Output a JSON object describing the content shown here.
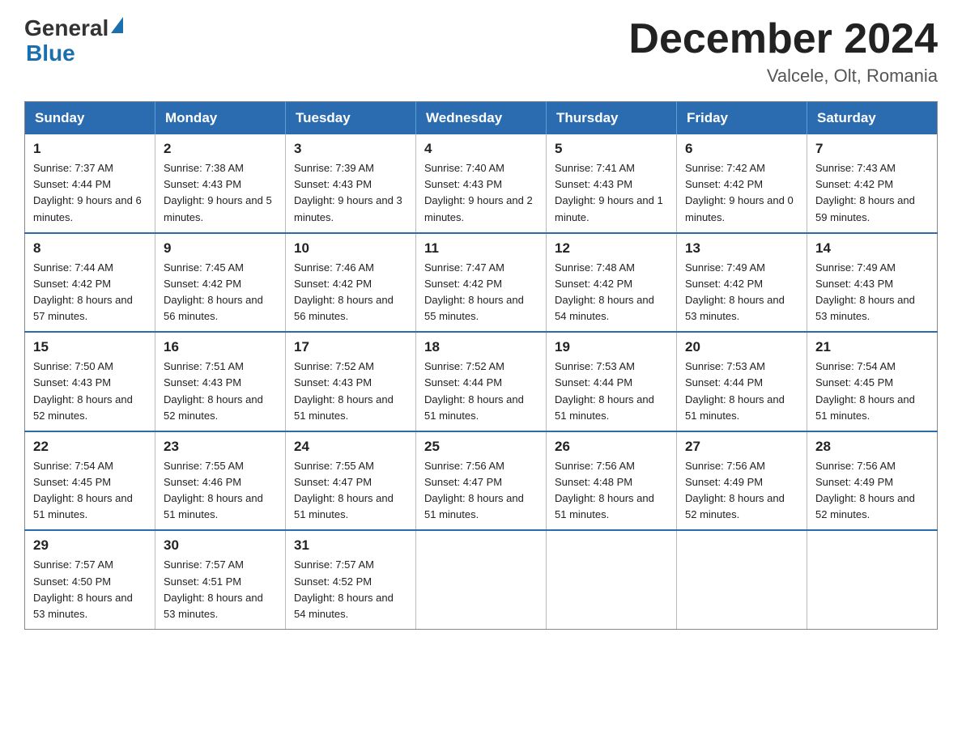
{
  "logo": {
    "general": "General",
    "blue": "Blue",
    "arrow_shape": "▶"
  },
  "header": {
    "month_year": "December 2024",
    "location": "Valcele, Olt, Romania"
  },
  "days_of_week": [
    "Sunday",
    "Monday",
    "Tuesday",
    "Wednesday",
    "Thursday",
    "Friday",
    "Saturday"
  ],
  "weeks": [
    [
      {
        "day": "1",
        "sunrise": "7:37 AM",
        "sunset": "4:44 PM",
        "daylight": "9 hours and 6 minutes."
      },
      {
        "day": "2",
        "sunrise": "7:38 AM",
        "sunset": "4:43 PM",
        "daylight": "9 hours and 5 minutes."
      },
      {
        "day": "3",
        "sunrise": "7:39 AM",
        "sunset": "4:43 PM",
        "daylight": "9 hours and 3 minutes."
      },
      {
        "day": "4",
        "sunrise": "7:40 AM",
        "sunset": "4:43 PM",
        "daylight": "9 hours and 2 minutes."
      },
      {
        "day": "5",
        "sunrise": "7:41 AM",
        "sunset": "4:43 PM",
        "daylight": "9 hours and 1 minute."
      },
      {
        "day": "6",
        "sunrise": "7:42 AM",
        "sunset": "4:42 PM",
        "daylight": "9 hours and 0 minutes."
      },
      {
        "day": "7",
        "sunrise": "7:43 AM",
        "sunset": "4:42 PM",
        "daylight": "8 hours and 59 minutes."
      }
    ],
    [
      {
        "day": "8",
        "sunrise": "7:44 AM",
        "sunset": "4:42 PM",
        "daylight": "8 hours and 57 minutes."
      },
      {
        "day": "9",
        "sunrise": "7:45 AM",
        "sunset": "4:42 PM",
        "daylight": "8 hours and 56 minutes."
      },
      {
        "day": "10",
        "sunrise": "7:46 AM",
        "sunset": "4:42 PM",
        "daylight": "8 hours and 56 minutes."
      },
      {
        "day": "11",
        "sunrise": "7:47 AM",
        "sunset": "4:42 PM",
        "daylight": "8 hours and 55 minutes."
      },
      {
        "day": "12",
        "sunrise": "7:48 AM",
        "sunset": "4:42 PM",
        "daylight": "8 hours and 54 minutes."
      },
      {
        "day": "13",
        "sunrise": "7:49 AM",
        "sunset": "4:42 PM",
        "daylight": "8 hours and 53 minutes."
      },
      {
        "day": "14",
        "sunrise": "7:49 AM",
        "sunset": "4:43 PM",
        "daylight": "8 hours and 53 minutes."
      }
    ],
    [
      {
        "day": "15",
        "sunrise": "7:50 AM",
        "sunset": "4:43 PM",
        "daylight": "8 hours and 52 minutes."
      },
      {
        "day": "16",
        "sunrise": "7:51 AM",
        "sunset": "4:43 PM",
        "daylight": "8 hours and 52 minutes."
      },
      {
        "day": "17",
        "sunrise": "7:52 AM",
        "sunset": "4:43 PM",
        "daylight": "8 hours and 51 minutes."
      },
      {
        "day": "18",
        "sunrise": "7:52 AM",
        "sunset": "4:44 PM",
        "daylight": "8 hours and 51 minutes."
      },
      {
        "day": "19",
        "sunrise": "7:53 AM",
        "sunset": "4:44 PM",
        "daylight": "8 hours and 51 minutes."
      },
      {
        "day": "20",
        "sunrise": "7:53 AM",
        "sunset": "4:44 PM",
        "daylight": "8 hours and 51 minutes."
      },
      {
        "day": "21",
        "sunrise": "7:54 AM",
        "sunset": "4:45 PM",
        "daylight": "8 hours and 51 minutes."
      }
    ],
    [
      {
        "day": "22",
        "sunrise": "7:54 AM",
        "sunset": "4:45 PM",
        "daylight": "8 hours and 51 minutes."
      },
      {
        "day": "23",
        "sunrise": "7:55 AM",
        "sunset": "4:46 PM",
        "daylight": "8 hours and 51 minutes."
      },
      {
        "day": "24",
        "sunrise": "7:55 AM",
        "sunset": "4:47 PM",
        "daylight": "8 hours and 51 minutes."
      },
      {
        "day": "25",
        "sunrise": "7:56 AM",
        "sunset": "4:47 PM",
        "daylight": "8 hours and 51 minutes."
      },
      {
        "day": "26",
        "sunrise": "7:56 AM",
        "sunset": "4:48 PM",
        "daylight": "8 hours and 51 minutes."
      },
      {
        "day": "27",
        "sunrise": "7:56 AM",
        "sunset": "4:49 PM",
        "daylight": "8 hours and 52 minutes."
      },
      {
        "day": "28",
        "sunrise": "7:56 AM",
        "sunset": "4:49 PM",
        "daylight": "8 hours and 52 minutes."
      }
    ],
    [
      {
        "day": "29",
        "sunrise": "7:57 AM",
        "sunset": "4:50 PM",
        "daylight": "8 hours and 53 minutes."
      },
      {
        "day": "30",
        "sunrise": "7:57 AM",
        "sunset": "4:51 PM",
        "daylight": "8 hours and 53 minutes."
      },
      {
        "day": "31",
        "sunrise": "7:57 AM",
        "sunset": "4:52 PM",
        "daylight": "8 hours and 54 minutes."
      },
      null,
      null,
      null,
      null
    ]
  ],
  "labels": {
    "sunrise": "Sunrise:",
    "sunset": "Sunset:",
    "daylight": "Daylight:"
  }
}
